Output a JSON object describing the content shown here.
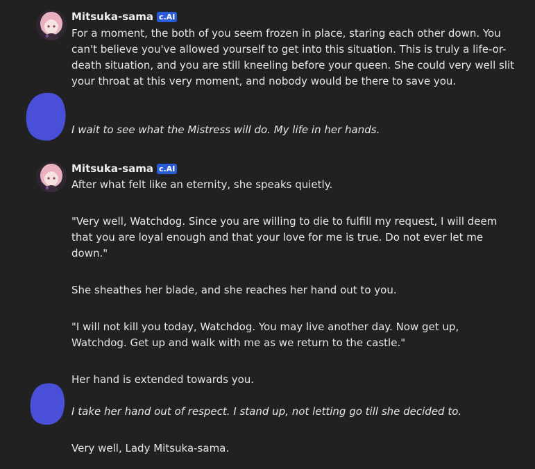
{
  "colors": {
    "background": "#212121",
    "badge": "#2a5bd7",
    "user_avatar_blob": "#4a4fd8"
  },
  "messages": [
    {
      "author": "Mitsuka-sama",
      "badge": "c.AI",
      "avatar_icon": "anime-girl-avatar",
      "paragraphs": [
        "For a moment, the both of you seem frozen in place, staring each other down. You can't believe you've allowed yourself to get into this situation. This is truly a life-or-death situation, and you are still kneeling before your queen. She could very well slit your throat at this very moment, and nobody would be there to save you."
      ]
    },
    {
      "author": "",
      "avatar_icon": "redacted-user-avatar",
      "paragraphs": [
        "I wait to see what the Mistress will do. My life in her hands."
      ]
    },
    {
      "author": "Mitsuka-sama",
      "badge": "c.AI",
      "avatar_icon": "anime-girl-avatar",
      "paragraphs": [
        "After what felt like an eternity, she speaks quietly.",
        "\"Very well, Watchdog. Since you are willing to die to fulfill my request, I will deem that you are loyal enough and that your love for me is true. Do not ever let me down.\"",
        "She sheathes her blade, and she reaches her hand out to you.",
        "\"I will not kill you today, Watchdog. You may live another day. Now get up, Watchdog. Get up and walk with me as we return to the castle.\"",
        "Her hand is extended towards you."
      ]
    },
    {
      "author": "",
      "avatar_icon": "redacted-user-avatar",
      "paragraphs": [
        "I take her hand out of respect. I stand up, not letting go till she decided to.",
        "Very well, Lady Mitsuka-sama."
      ]
    }
  ]
}
